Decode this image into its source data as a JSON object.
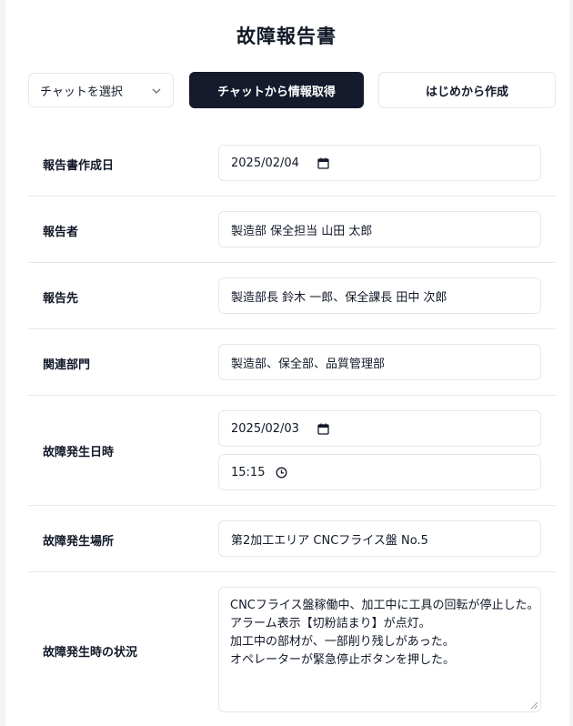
{
  "title": "故障報告書",
  "toolbar": {
    "chat_select_value": "チャットを選択",
    "fetch_button": "チャットから情報取得",
    "new_button": "はじめから作成"
  },
  "form": {
    "report_date": {
      "label": "報告書作成日",
      "value": "2025/02/04"
    },
    "reporter": {
      "label": "報告者",
      "value": "製造部 保全担当 山田 太郎"
    },
    "recipient": {
      "label": "報告先",
      "value": "製造部長 鈴木 一郎、保全課長 田中 次郎"
    },
    "departments": {
      "label": "関連部門",
      "value": "製造部、保全部、品質管理部"
    },
    "failure_datetime": {
      "label": "故障発生日時",
      "date": "2025/02/03",
      "time": "15:15"
    },
    "failure_location": {
      "label": "故障発生場所",
      "value": "第2加工エリア CNCフライス盤 No.5"
    },
    "failure_situation": {
      "label": "故障発生時の状況",
      "lines": [
        "CNCフライス盤稼働中、加工中に工具の回転が停止した。",
        "アラーム表示【切粉詰まり】が点灯。",
        "加工中の部材が、一部削り残しがあった。",
        "オペレーターが緊急停止ボタンを押した。"
      ]
    }
  },
  "icons": {
    "select_chevron": "chevron-down-icon",
    "date": "calendar-icon",
    "time": "clock-icon",
    "textarea_resize": "resize-handle-icon"
  },
  "colors": {
    "primary_button_bg": "#151b2d",
    "border": "#e5e7eb",
    "text": "#111827"
  }
}
